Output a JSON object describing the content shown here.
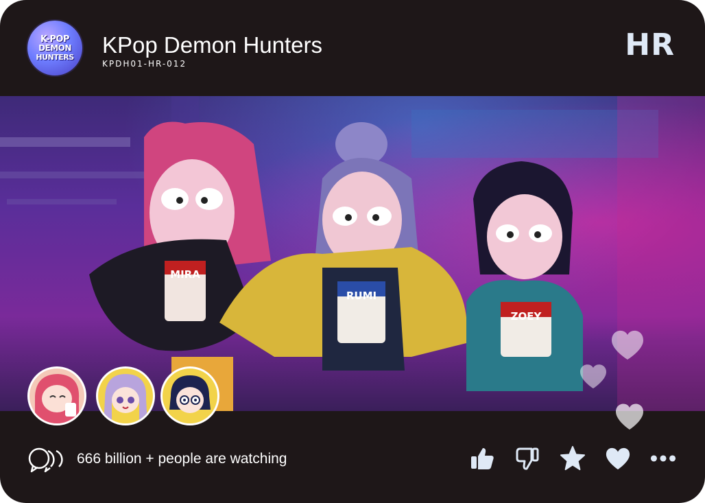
{
  "header": {
    "logo_text": [
      "K-POP",
      "DEMON",
      "HUNTERS"
    ],
    "title": "KPop Demon Hunters",
    "card_code": "KPDH01-HR-012",
    "rarity": "HR"
  },
  "scene": {
    "cup_labels": [
      "MIRA",
      "RUMI",
      "ZOEY"
    ]
  },
  "avatars": [
    {
      "name": "mira-avatar"
    },
    {
      "name": "rumi-avatar"
    },
    {
      "name": "zoey-avatar"
    }
  ],
  "footer": {
    "watching_text": "666 billion + people are watching",
    "actions": [
      "thumbs-up-icon",
      "thumbs-down-icon",
      "star-icon",
      "heart-icon",
      "more-icon"
    ]
  },
  "colors": {
    "card_bg": "#1e1718",
    "text": "#ffffff",
    "icon": "#dfe9f6",
    "scene_purple": "#5a2e9a"
  }
}
